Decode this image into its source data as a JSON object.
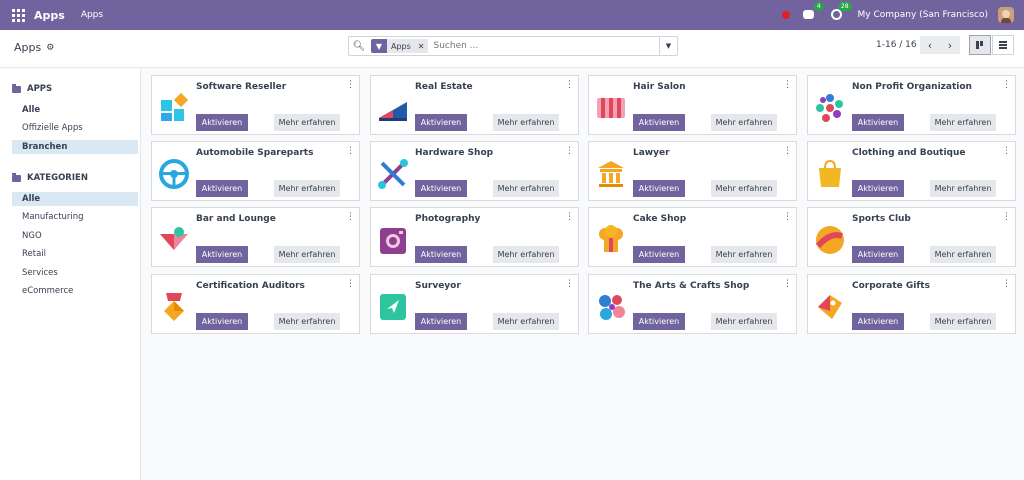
{
  "navbar": {
    "brand": "Apps",
    "menu": "Apps",
    "messages_badge": "4",
    "activities_badge": "28",
    "company": "My Company (San Francisco)"
  },
  "control_panel": {
    "title": "Apps",
    "search": {
      "facet_label": "Apps",
      "placeholder": "Suchen ..."
    },
    "pager": "1-16 / 16"
  },
  "sidebar": {
    "apps_header": "APPS",
    "apps_items": [
      "Alle",
      "Offizielle Apps",
      "Branchen"
    ],
    "categories_header": "KATEGORIEN",
    "category_items": [
      "Alle",
      "Manufacturing",
      "NGO",
      "Retail",
      "Services",
      "eCommerce"
    ]
  },
  "buttons": {
    "activate": "Aktivieren",
    "learn_more": "Mehr erfahren"
  },
  "apps": [
    {
      "name": "Software Reseller",
      "icon": "software-reseller-icon"
    },
    {
      "name": "Real Estate",
      "icon": "real-estate-icon"
    },
    {
      "name": "Hair Salon",
      "icon": "hair-salon-icon"
    },
    {
      "name": "Non Profit Organization",
      "icon": "non-profit-icon"
    },
    {
      "name": "Automobile Spareparts",
      "icon": "steering-wheel-icon"
    },
    {
      "name": "Hardware Shop",
      "icon": "hardware-tools-icon"
    },
    {
      "name": "Lawyer",
      "icon": "lawyer-icon"
    },
    {
      "name": "Clothing and Boutique",
      "icon": "shopping-bag-icon"
    },
    {
      "name": "Bar and Lounge",
      "icon": "cocktail-icon"
    },
    {
      "name": "Photography",
      "icon": "camera-icon"
    },
    {
      "name": "Cake Shop",
      "icon": "chef-hat-icon"
    },
    {
      "name": "Sports Club",
      "icon": "ball-icon"
    },
    {
      "name": "Certification Auditors",
      "icon": "medal-icon"
    },
    {
      "name": "Surveyor",
      "icon": "compass-icon"
    },
    {
      "name": "The Arts & Crafts Shop",
      "icon": "palette-icon"
    },
    {
      "name": "Corporate Gifts",
      "icon": "gift-tag-icon"
    }
  ],
  "colors": {
    "brand": "#71639e",
    "active_filter": "#d9e8f3"
  }
}
